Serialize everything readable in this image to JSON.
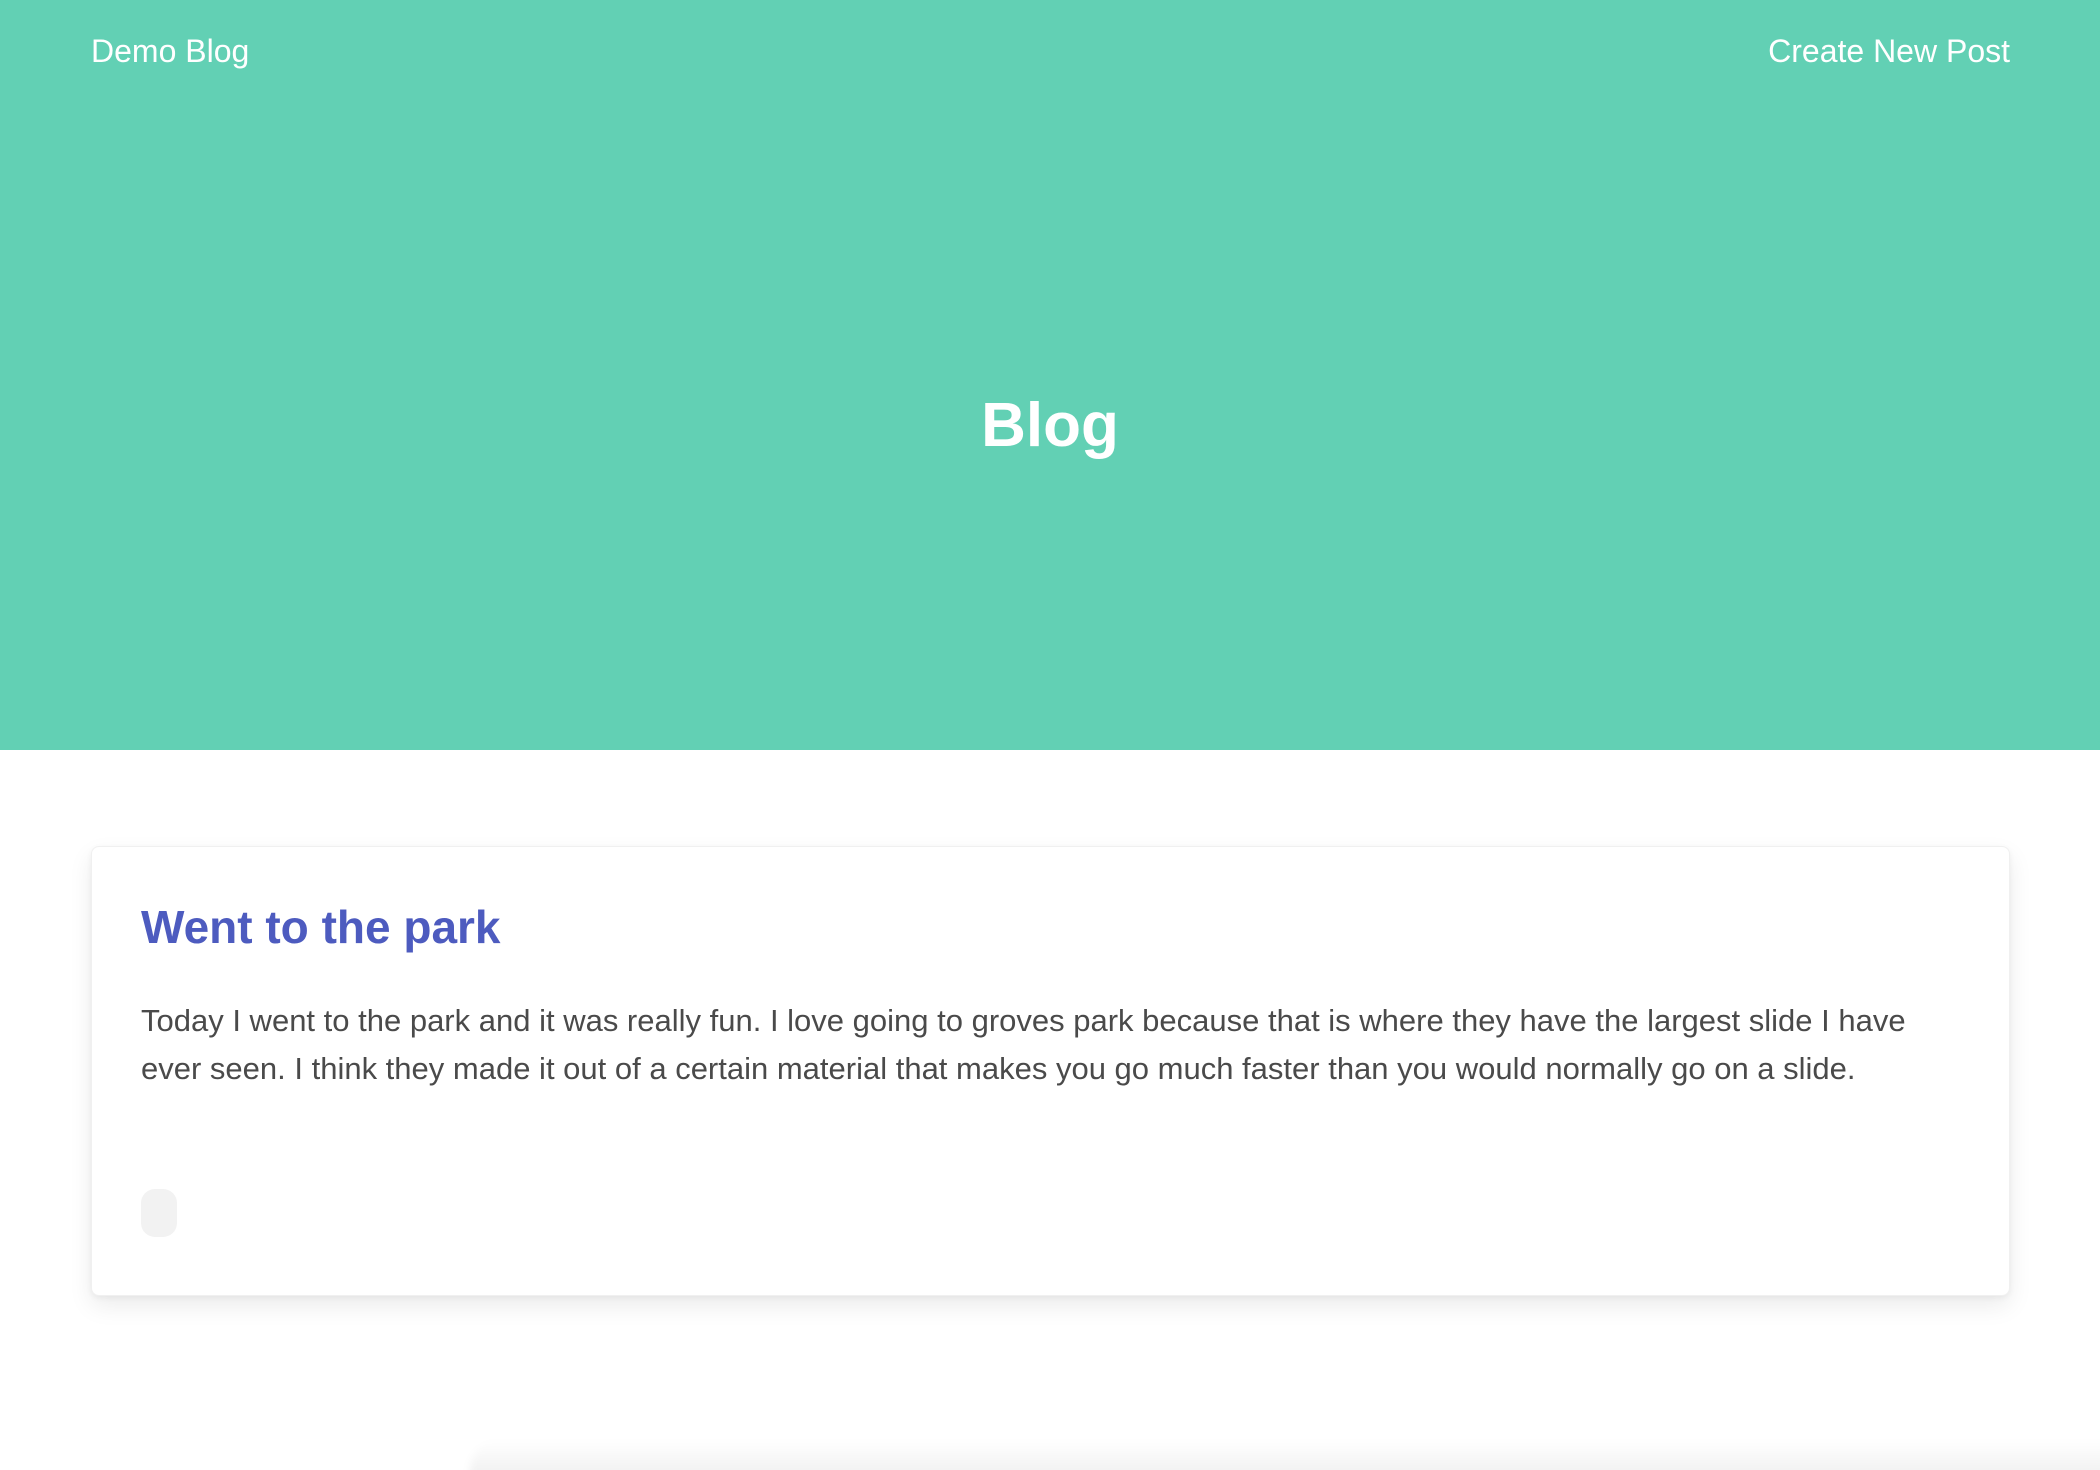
{
  "nav": {
    "brand": "Demo Blog",
    "create_post": "Create New Post"
  },
  "hero": {
    "title": "Blog"
  },
  "colors": {
    "hero_background": "#62d0b4",
    "post_title": "#4d5bbf",
    "body_text": "#4a4a4a"
  },
  "posts": [
    {
      "title": "Went to the park",
      "body": "Today I went to the park and it was really fun. I love going to groves park because that is where they have the largest slide I have ever seen. I think they made it out of a certain material that makes you go much faster than you would normally go on a slide."
    }
  ]
}
